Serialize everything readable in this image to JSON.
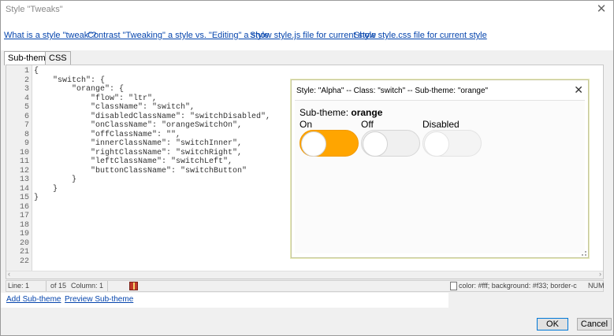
{
  "window": {
    "title": "Style \"Tweaks\""
  },
  "links": {
    "what_is_tweak": "What is a style \"tweak\"?",
    "contrast": "Contrast \"Tweaking\" a style vs. \"Editing\" a style",
    "show_js": "Show style.js file for current style",
    "show_css": "Show style.css file for current style"
  },
  "tabs": [
    "Sub-themes",
    "CSS"
  ],
  "editor": {
    "line_numbers": [
      "1",
      "2",
      "3",
      "4",
      "5",
      "6",
      "7",
      "8",
      "9",
      "10",
      "11",
      "12",
      "13",
      "14",
      "15",
      "16",
      "17",
      "18",
      "19",
      "20",
      "21",
      "22"
    ],
    "lines": [
      "{",
      "    \"switch\": {",
      "        \"orange\": {",
      "            \"flow\": \"ltr\",",
      "            \"className\": \"switch\",",
      "            \"disabledClassName\": \"switchDisabled\",",
      "            \"onClassName\": \"orangeSwitchOn\",",
      "            \"offClassName\": \"\",",
      "            \"innerClassName\": \"switchInner\",",
      "            \"rightClassName\": \"switchRight\",",
      "            \"leftClassName\": \"switchLeft\",",
      "            \"buttonClassName\": \"switchButton\"",
      "        }",
      "    }",
      "}"
    ]
  },
  "status": {
    "line": "Line: 1",
    "of": "of 15",
    "column": "Column: 1",
    "css_preview": "color: #fff; background: #f33; border-c",
    "num": "NUM"
  },
  "sublinks": {
    "add": "Add Sub-theme",
    "preview": "Preview Sub-theme"
  },
  "buttons": {
    "ok": "OK",
    "cancel": "Cancel"
  },
  "popup": {
    "title": "Style: \"Alpha\"  -- Class: \"switch\" -- Sub-theme: \"orange\"",
    "subtheme_prefix": "Sub-theme: ",
    "subtheme_name": "orange",
    "switches": [
      {
        "label": "On",
        "state": "on"
      },
      {
        "label": "Off",
        "state": "off"
      },
      {
        "label": "Disabled",
        "state": "disabled"
      }
    ]
  },
  "colors": {
    "switch_on": "#ffa500",
    "link": "#0645ad"
  }
}
